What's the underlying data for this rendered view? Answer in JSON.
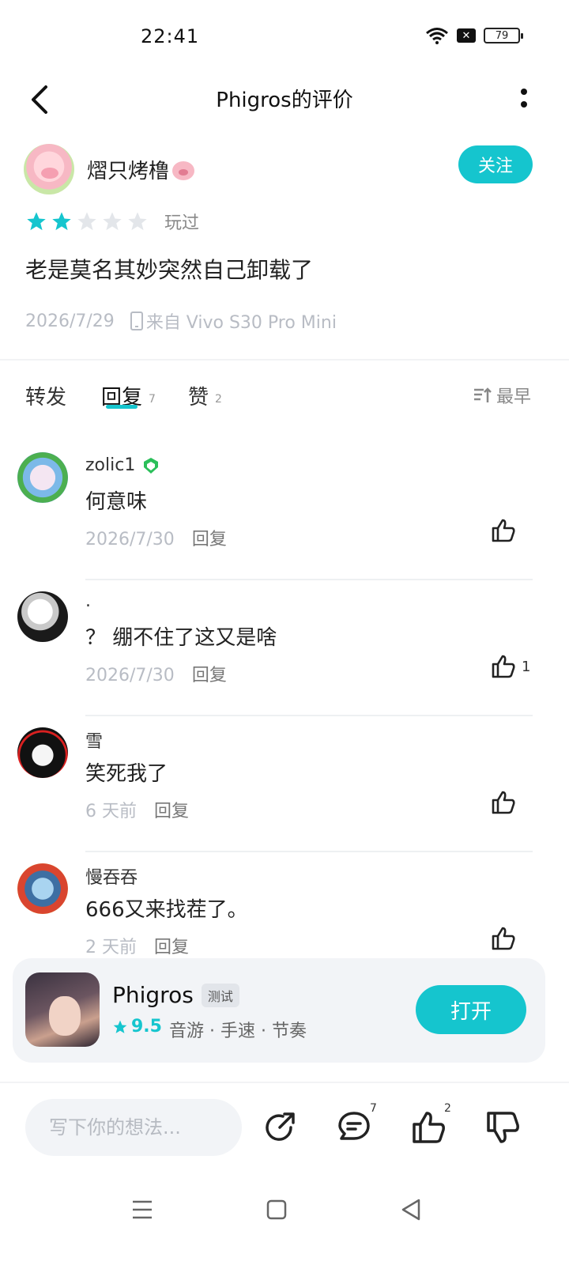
{
  "status_bar": {
    "time": "22:41",
    "battery": "79"
  },
  "header": {
    "title": "Phigros的评价"
  },
  "review": {
    "username": "熠只烤橹",
    "follow_label": "关注",
    "rating_stars": 2,
    "rating_max": 5,
    "played_label": "玩过",
    "text": "老是莫名其妙突然自己卸载了",
    "date": "2026/7/29",
    "device": "来自 Vivo S30 Pro Mini"
  },
  "tabs": {
    "repost": "转发",
    "reply": "回复",
    "reply_count": "7",
    "like": "赞",
    "like_count": "2",
    "sort": "最早"
  },
  "comments": [
    {
      "name": "zolic1",
      "text": "何意味",
      "date": "2026/7/30",
      "reply": "回复",
      "likes": ""
    },
    {
      "name": ".",
      "text": "？ 绷不住了这又是啥",
      "date": "2026/7/30",
      "reply": "回复",
      "likes": "1"
    },
    {
      "name": "雪",
      "text": "笑死我了",
      "date": "6 天前",
      "reply": "回复",
      "likes": ""
    },
    {
      "name": "慢吞吞",
      "text": "666又来找茬了。",
      "date": "2 天前",
      "reply": "回复",
      "likes": ""
    }
  ],
  "app_card": {
    "name": "Phigros",
    "tag": "测试",
    "rating": "9.5",
    "genres": "音游 · 手速 · 节奏",
    "open_label": "打开"
  },
  "bottom_bar": {
    "input_placeholder": "写下你的想法...",
    "comment_count": "7",
    "like_count": "2"
  },
  "colors": {
    "accent": "#15c5ce",
    "muted": "#b8bcc4"
  }
}
